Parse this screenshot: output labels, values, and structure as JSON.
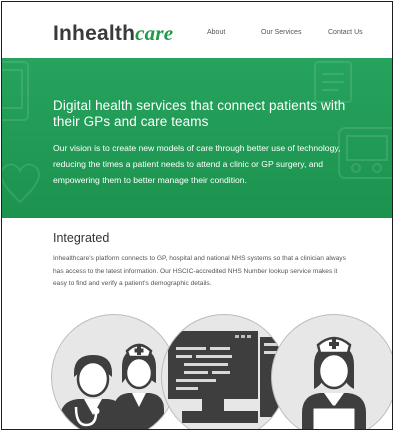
{
  "header": {
    "logo": {
      "text_plain": "Inhealth",
      "text_accent": "care"
    },
    "nav": [
      {
        "label": "About"
      },
      {
        "label": "Our Services"
      },
      {
        "label": "Contact Us"
      }
    ]
  },
  "hero": {
    "title": "Digital health services that connect patients with their GPs and care teams",
    "text": "Our vision is to create new models of care through better use of technology, reducing the times a patient needs to attend a clinic or GP surgery, and empowering them to better manage their condition."
  },
  "integrated": {
    "title": "Integrated",
    "text": "Inhealthcare's platform connects to GP, hospital and national NHS systems so that a clinician always has access to the latest information. Our HSCIC-accredited NHS Number lookup service makes it easy to find and verify a patient's demographic details."
  },
  "illustrations": [
    {
      "icon": "doctor-nurse-icon"
    },
    {
      "icon": "computer-code-icon"
    },
    {
      "icon": "nurse-laptop-icon"
    }
  ],
  "colors": {
    "brand_green": "#1f9a48",
    "hero_green": "#22a058",
    "text_dark": "#333333",
    "circle_bg": "#e7e7e7"
  }
}
